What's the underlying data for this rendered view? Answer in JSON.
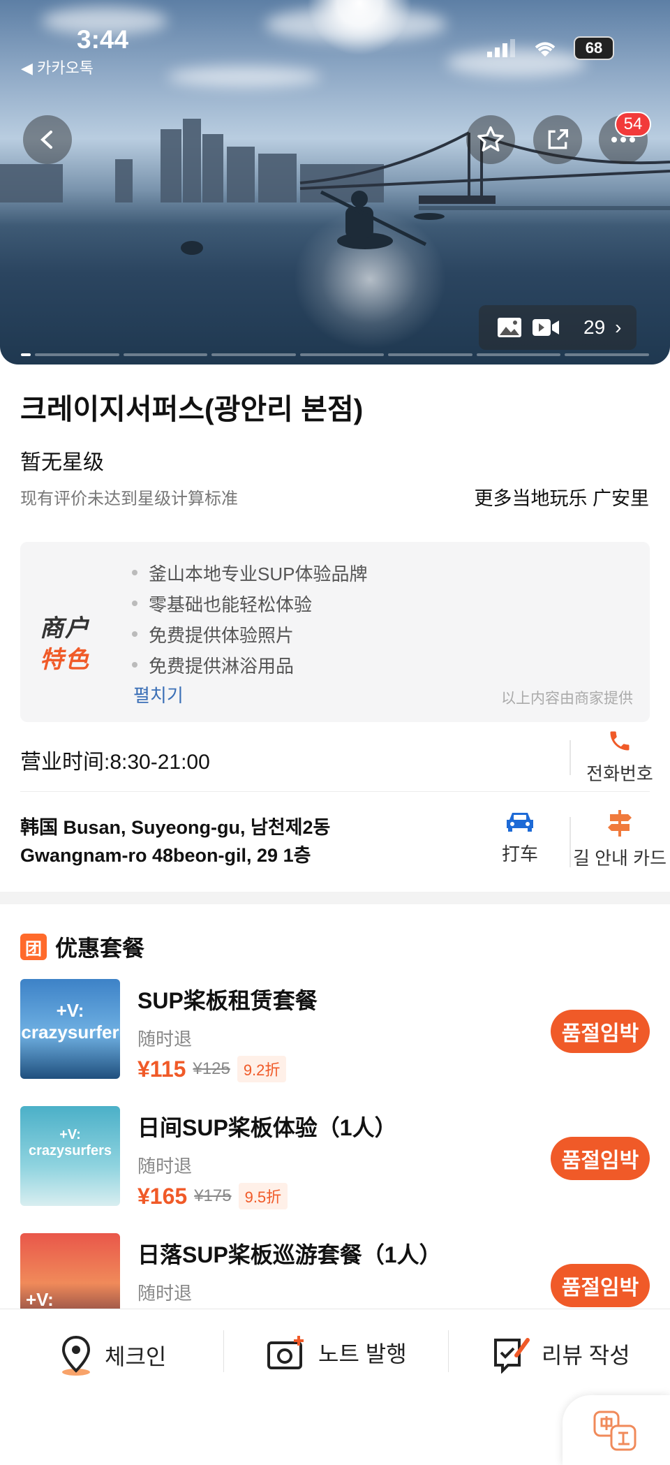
{
  "status_bar": {
    "time": "3:44",
    "back_app": "◀ 카카오톡",
    "battery": "68"
  },
  "hero": {
    "media_count": "29",
    "notification_badge": "54"
  },
  "place": {
    "title": "크레이지서퍼스(광안리 본점)",
    "rating_label": "暂无星级",
    "rating_note": "现有评价未达到星级计算标准",
    "more_local": "更多当地玩乐 广安里"
  },
  "merchant_features": {
    "logo_line1": "商户",
    "logo_line2": "特色",
    "items": [
      "釜山本地专业SUP体验品牌",
      "零基础也能轻松体验",
      "免费提供体验照片",
      "免费提供淋浴用品"
    ],
    "expand_label": "펼치기",
    "provided_note": "以上内容由商家提供"
  },
  "contact": {
    "hours": "营业时间:8:30-21:00",
    "phone_label": "전화번호",
    "address_line1": "韩国 Busan, Suyeong-gu, 남천제2동",
    "address_line2": "Gwangnam-ro 48beon-gil, 29 1층",
    "taxi_label": "打车",
    "nav_label": "길 안내 카드"
  },
  "deals": {
    "badge": "团",
    "title": "优惠套餐",
    "items": [
      {
        "name": "SUP桨板租赁套餐",
        "refund": "随时退",
        "price": "¥115",
        "orig_price": "¥125",
        "discount": "9.2折",
        "button": "품절임박",
        "thumb_text": "+V: crazysurfer"
      },
      {
        "name": "日间SUP桨板体验（1人）",
        "refund": "随时退",
        "price": "¥165",
        "orig_price": "¥175",
        "discount": "9.5折",
        "button": "품절임박",
        "thumb_text": "+V: crazysurfers"
      },
      {
        "name": "日落SUP桨板巡游套餐（1人）",
        "refund": "随时退",
        "button": "품절임박",
        "thumb_text": "+V:"
      }
    ]
  },
  "bottom_bar": {
    "checkin": "체크인",
    "note": "노트 발행",
    "review": "리뷰 작성"
  },
  "colors": {
    "accent": "#f05a28",
    "link": "#3b6fb6",
    "badge_red": "#f23a3a"
  }
}
